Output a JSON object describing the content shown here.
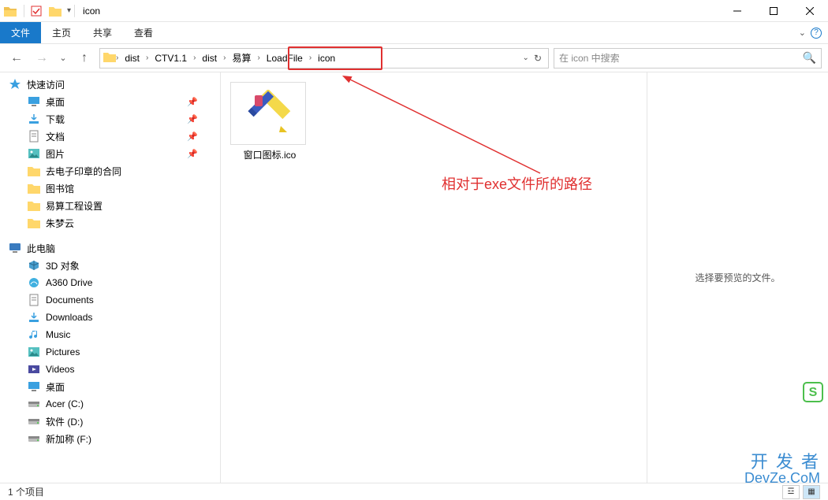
{
  "window": {
    "title": "icon"
  },
  "ribbon": {
    "tabs": {
      "file": "文件",
      "home": "主页",
      "share": "共享",
      "view": "查看"
    }
  },
  "nav": {
    "breadcrumb": [
      "dist",
      "CTV1.1",
      "dist",
      "易算",
      "LoadFile",
      "icon"
    ],
    "search_placeholder": "在 icon 中搜索"
  },
  "sidebar": {
    "quick_access": "快速访问",
    "items_qa": [
      {
        "label": "桌面",
        "icon": "desktop",
        "pin": true
      },
      {
        "label": "下载",
        "icon": "download",
        "pin": true
      },
      {
        "label": "文档",
        "icon": "document",
        "pin": true
      },
      {
        "label": "图片",
        "icon": "pictures",
        "pin": true
      },
      {
        "label": "去电子印章的合同",
        "icon": "folder",
        "pin": false
      },
      {
        "label": "图书馆",
        "icon": "folder",
        "pin": false
      },
      {
        "label": "易算工程设置",
        "icon": "folder",
        "pin": false
      },
      {
        "label": "朱梦云",
        "icon": "folder",
        "pin": false
      }
    ],
    "this_pc": "此电脑",
    "items_pc": [
      {
        "label": "3D 对象",
        "icon": "3d"
      },
      {
        "label": "A360 Drive",
        "icon": "a360"
      },
      {
        "label": "Documents",
        "icon": "document"
      },
      {
        "label": "Downloads",
        "icon": "download"
      },
      {
        "label": "Music",
        "icon": "music"
      },
      {
        "label": "Pictures",
        "icon": "pictures"
      },
      {
        "label": "Videos",
        "icon": "videos"
      },
      {
        "label": "桌面",
        "icon": "desktop"
      },
      {
        "label": "Acer (C:)",
        "icon": "drive"
      },
      {
        "label": "软件 (D:)",
        "icon": "drive"
      },
      {
        "label": "新加称 (F:)",
        "icon": "drive"
      }
    ]
  },
  "content": {
    "files": [
      {
        "name": "窗口图标.ico",
        "type": "ico"
      }
    ]
  },
  "preview": {
    "empty_text": "选择要预览的文件。"
  },
  "status": {
    "count_text": "1 个项目"
  },
  "annotation": {
    "text": "相对于exe文件所的路径"
  },
  "watermark": {
    "line1": "开 发 者",
    "line2": "DevZe.CoM"
  }
}
